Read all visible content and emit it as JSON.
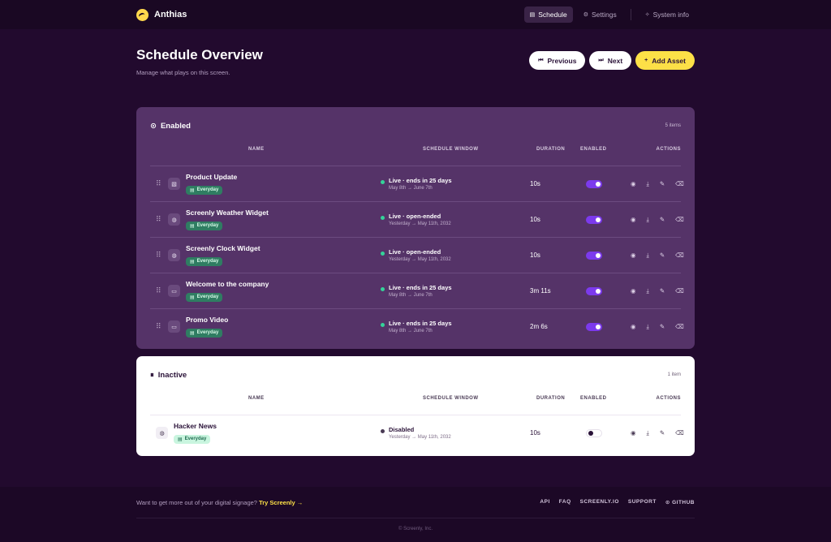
{
  "app": {
    "name": "Anthias"
  },
  "nav": [
    {
      "label": "Schedule",
      "icon": "calendar-icon",
      "glyph": "▤"
    },
    {
      "label": "Settings",
      "icon": "gear-icon",
      "glyph": "⚙"
    },
    {
      "label": "System info",
      "icon": "spark-icon",
      "glyph": "✧"
    }
  ],
  "header": {
    "title": "Schedule Overview",
    "subtitle": "Manage what plays on this screen.",
    "previous_label": "Previous",
    "next_label": "Next",
    "add_label": "Add Asset"
  },
  "columns": {
    "name": "NAME",
    "window": "SCHEDULE WINDOW",
    "duration": "DURATION",
    "enabled": "ENABLED",
    "actions": "ACTIONS"
  },
  "enabled_section": {
    "title": "Enabled",
    "count": "5 items",
    "assets": [
      {
        "name": "Product Update",
        "type_icon": "image-icon",
        "glyph": "▧",
        "badge": "Everyday",
        "status": "Live · ends in 25 days",
        "range": "May 8th → June 7th",
        "duration": "10s",
        "enabled": true
      },
      {
        "name": "Screenly Weather Widget",
        "type_icon": "globe-icon",
        "glyph": "◍",
        "badge": "Everyday",
        "status": "Live · open-ended",
        "range": "Yesterday → May 11th, 2032",
        "duration": "10s",
        "enabled": true
      },
      {
        "name": "Screenly Clock Widget",
        "type_icon": "globe-icon",
        "glyph": "◍",
        "badge": "Everyday",
        "status": "Live · open-ended",
        "range": "Yesterday → May 11th, 2032",
        "duration": "10s",
        "enabled": true
      },
      {
        "name": "Welcome to the company",
        "type_icon": "video-icon",
        "glyph": "▭",
        "badge": "Everyday",
        "status": "Live · ends in 25 days",
        "range": "May 8th → June 7th",
        "duration": "3m 11s",
        "enabled": true
      },
      {
        "name": "Promo Video",
        "type_icon": "video-icon",
        "glyph": "▭",
        "badge": "Everyday",
        "status": "Live · ends in 25 days",
        "range": "May 8th → June 7th",
        "duration": "2m 6s",
        "enabled": true
      }
    ]
  },
  "inactive_section": {
    "title": "Inactive",
    "count": "1 item",
    "assets": [
      {
        "name": "Hacker News",
        "type_icon": "globe-icon",
        "glyph": "◍",
        "badge": "Everyday",
        "status": "Disabled",
        "range": "Yesterday → May 11th, 2032",
        "duration": "10s",
        "enabled": false
      }
    ]
  },
  "footer": {
    "prompt": "Want to get more out of your digital signage?",
    "cta": "Try Screenly →",
    "links": [
      "API",
      "FAQ",
      "SCREENLY.IO",
      "SUPPORT",
      "GITHUB"
    ],
    "copyright": "© Screenly, Inc."
  },
  "colors": {
    "background": "#220a2e",
    "accent": "#fde047",
    "toggle_on": "#7c3aed",
    "live": "#34d399"
  }
}
